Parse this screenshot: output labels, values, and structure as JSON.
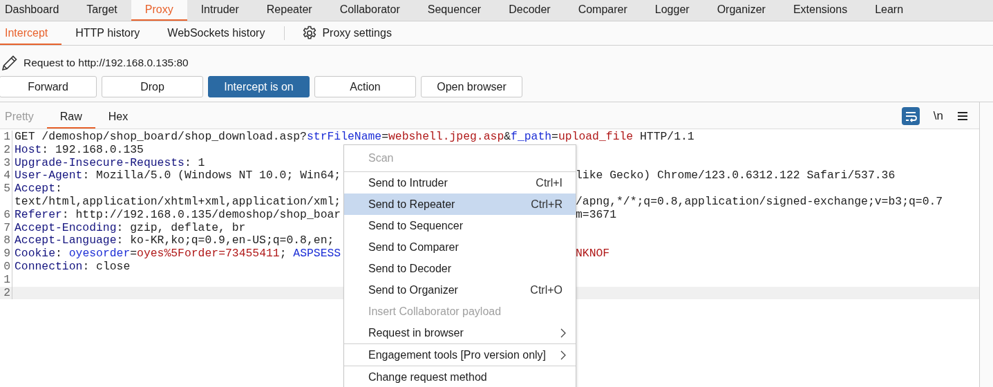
{
  "main_tabs": [
    {
      "label": "Dashboard",
      "selected": false
    },
    {
      "label": "Target",
      "selected": false
    },
    {
      "label": "Proxy",
      "selected": true
    },
    {
      "label": "Intruder",
      "selected": false
    },
    {
      "label": "Repeater",
      "selected": false
    },
    {
      "label": "Collaborator",
      "selected": false
    },
    {
      "label": "Sequencer",
      "selected": false
    },
    {
      "label": "Decoder",
      "selected": false
    },
    {
      "label": "Comparer",
      "selected": false
    },
    {
      "label": "Logger",
      "selected": false
    },
    {
      "label": "Organizer",
      "selected": false
    },
    {
      "label": "Extensions",
      "selected": false
    },
    {
      "label": "Learn",
      "selected": false
    }
  ],
  "sub_tabs": [
    {
      "label": "Intercept",
      "selected": true
    },
    {
      "label": "HTTP history",
      "selected": false
    },
    {
      "label": "WebSockets history",
      "selected": false
    }
  ],
  "settings_link": "Proxy settings",
  "request_label": "Request to http://192.168.0.135:80",
  "buttons": [
    {
      "label": "Forward",
      "on": false
    },
    {
      "label": "Drop",
      "on": false
    },
    {
      "label": "Intercept is on",
      "on": true
    },
    {
      "label": "Action",
      "on": false
    },
    {
      "label": "Open browser",
      "on": false
    }
  ],
  "editor_tabs": [
    {
      "label": "Pretty",
      "selected": false,
      "disabled": true
    },
    {
      "label": "Raw",
      "selected": true,
      "disabled": false
    },
    {
      "label": "Hex",
      "selected": false,
      "disabled": false
    }
  ],
  "editor_tools": {
    "wrap_on": true,
    "newline_toggle": "\\n"
  },
  "lines": [
    {
      "number": "1",
      "current": false,
      "left": [
        {
          "kind": "plain",
          "text": "GET /demoshop/shop_board/shop_download.asp?"
        },
        {
          "kind": "param",
          "text": "strFileName"
        },
        {
          "kind": "plain",
          "text": "="
        },
        {
          "kind": "value",
          "text": "webshell.jpeg.asp"
        },
        {
          "kind": "plain",
          "text": "&"
        },
        {
          "kind": "param",
          "text": "f_path"
        },
        {
          "kind": "plain",
          "text": "="
        },
        {
          "kind": "value",
          "text": "upload_file"
        },
        {
          "kind": "plain",
          "text": " HTTP/1.1"
        }
      ]
    },
    {
      "number": "2",
      "current": false,
      "left": [
        {
          "kind": "name",
          "text": "Host"
        },
        {
          "kind": "plain",
          "text": ": 192.168.0.135"
        }
      ]
    },
    {
      "number": "3",
      "current": false,
      "left": [
        {
          "kind": "name",
          "text": "Upgrade-Insecure-Requests"
        },
        {
          "kind": "plain",
          "text": ": 1"
        }
      ]
    },
    {
      "number": "4",
      "current": false,
      "left": [
        {
          "kind": "name",
          "text": "User-Agent"
        },
        {
          "kind": "plain",
          "text": ": Mozilla/5.0 (Windows NT 10.0; Win64;"
        }
      ],
      "right": [
        {
          "kind": "plain",
          "text": "like Gecko) Chrome/123.0.6312.122 Safari/537.36"
        }
      ]
    },
    {
      "number": "5",
      "current": false,
      "left": [
        {
          "kind": "name",
          "text": "Accept"
        },
        {
          "kind": "plain",
          "text": ":"
        }
      ]
    },
    {
      "current": false,
      "left": [
        {
          "kind": "plain",
          "text": "text/html,application/xhtml+xml,application/xml;"
        }
      ],
      "right": [
        {
          "kind": "plain",
          "text": "/apng,*/*;q=0.8,application/signed-exchange;v=b3;q=0.7"
        }
      ]
    },
    {
      "number": "6",
      "current": false,
      "left": [
        {
          "kind": "name",
          "text": "Referer"
        },
        {
          "kind": "plain",
          "text": ": http://192.168.0.135/demoshop/shop_boar"
        }
      ],
      "right": [
        {
          "kind": "plain",
          "text": "m=3671"
        }
      ]
    },
    {
      "number": "7",
      "current": false,
      "left": [
        {
          "kind": "name",
          "text": "Accept-Encoding"
        },
        {
          "kind": "plain",
          "text": ": gzip, deflate, br"
        }
      ]
    },
    {
      "number": "8",
      "current": false,
      "left": [
        {
          "kind": "name",
          "text": "Accept-Language"
        },
        {
          "kind": "plain",
          "text": ": ko-KR,ko;q=0.9,en-US;q=0.8,en;"
        }
      ]
    },
    {
      "number": "9",
      "current": false,
      "left": [
        {
          "kind": "name",
          "text": "Cookie"
        },
        {
          "kind": "plain",
          "text": ": "
        },
        {
          "kind": "param",
          "text": "oyesorder"
        },
        {
          "kind": "plain",
          "text": "="
        },
        {
          "kind": "value",
          "text": "oyes%5Forder=73455411"
        },
        {
          "kind": "plain",
          "text": "; "
        },
        {
          "kind": "param",
          "text": "ASPSESS"
        }
      ],
      "right": [
        {
          "kind": "value",
          "text": "NKNOF"
        }
      ]
    },
    {
      "number": "0",
      "current": false,
      "left": [
        {
          "kind": "name",
          "text": "Connection"
        },
        {
          "kind": "plain",
          "text": ": close"
        }
      ]
    },
    {
      "number": "1",
      "current": false
    },
    {
      "number": "2",
      "current": true
    }
  ],
  "context_menu": {
    "groups": [
      [
        {
          "label": "Scan",
          "disabled": true,
          "selected": false,
          "submenu": false
        }
      ],
      [
        {
          "label": "Send to Intruder",
          "shortcut": "Ctrl+I",
          "disabled": false,
          "selected": false,
          "submenu": false
        },
        {
          "label": "Send to Repeater",
          "shortcut": "Ctrl+R",
          "disabled": false,
          "selected": true,
          "submenu": false
        },
        {
          "label": "Send to Sequencer",
          "disabled": false,
          "selected": false,
          "submenu": false
        },
        {
          "label": "Send to Comparer",
          "disabled": false,
          "selected": false,
          "submenu": false
        },
        {
          "label": "Send to Decoder",
          "disabled": false,
          "selected": false,
          "submenu": false
        },
        {
          "label": "Send to Organizer",
          "shortcut": "Ctrl+O",
          "disabled": false,
          "selected": false,
          "submenu": false
        },
        {
          "label": "Insert Collaborator payload",
          "disabled": true,
          "selected": false,
          "submenu": false
        },
        {
          "label": "Request in browser",
          "disabled": false,
          "selected": false,
          "submenu": true
        }
      ],
      [
        {
          "label": "Engagement tools [Pro version only]",
          "disabled": false,
          "selected": false,
          "submenu": true
        }
      ],
      [
        {
          "label": "Change request method",
          "disabled": false,
          "selected": false,
          "submenu": false
        }
      ]
    ]
  }
}
